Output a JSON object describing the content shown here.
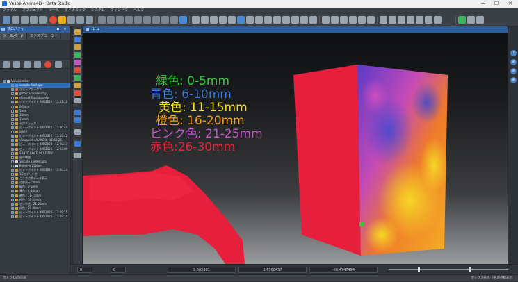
{
  "window": {
    "title": "Vesoe Anima4D - Data Studio",
    "min": "—",
    "max": "☐",
    "close": "✕"
  },
  "menu": [
    "ファイル",
    "オブジェクト",
    "ツール",
    "ダイナミック",
    "システム",
    "ウィンドウ",
    "ヘルプ"
  ],
  "left_panel": {
    "title": "プロパティ",
    "tabs": [
      "ツールボード",
      "エクスプローラー"
    ],
    "tree": [
      {
        "label": "ViewpointSet",
        "checked": true,
        "color": "#cfd5db",
        "indent": 0
      },
      {
        "label": "sample-filed.npo",
        "checked": true,
        "color": "#5aa0e0",
        "indent": 1,
        "selected": true
      },
      {
        "label": "クリップボックス",
        "checked": true,
        "color": "#e06060",
        "indent": 1
      },
      {
        "label": "glitter Stashbounty",
        "checked": false,
        "color": "#d0a040",
        "indent": 1
      },
      {
        "label": "skimset Stashbounty",
        "checked": false,
        "color": "#d0a040",
        "indent": 1
      },
      {
        "label": "ビューポイント 4/6/2020 - 11:31:10",
        "checked": true,
        "color": "#d0a040",
        "indent": 1
      },
      {
        "label": "0-5mm",
        "checked": false,
        "color": "#d0a040",
        "indent": 1
      },
      {
        "label": "5mm",
        "checked": false,
        "color": "#d0a040",
        "indent": 1
      },
      {
        "label": "10mm",
        "checked": false,
        "color": "#d0a040",
        "indent": 1
      },
      {
        "label": "15mm",
        "checked": false,
        "color": "#d0a040",
        "indent": 1
      },
      {
        "label": "干渉チェック",
        "checked": false,
        "color": "#d0a040",
        "indent": 1
      },
      {
        "label": "ビューポイント 4/6/2020 - 11:46:44",
        "checked": true,
        "color": "#d0a040",
        "indent": 1
      },
      {
        "label": "説明文",
        "checked": false,
        "color": "#d0a040",
        "indent": 1
      },
      {
        "label": "ビューポイント 4/6/2020 - 11:59:42",
        "checked": true,
        "color": "#d0a040",
        "indent": 1
      },
      {
        "label": "Viewpoint 4/6/2020 - 11:59:26",
        "checked": true,
        "color": "#d0a040",
        "indent": 1
      },
      {
        "label": "ビューポイント 4/6/2020 - 12:00:17",
        "checked": true,
        "color": "#d0a040",
        "indent": 1
      },
      {
        "label": "ビューポイント 4/6/2020 - 12:03:09",
        "checked": true,
        "color": "#d0a040",
        "indent": 1
      },
      {
        "label": "SANYO ROAD INDUSTRY",
        "checked": false,
        "color": "#d0a040",
        "indent": 1
      },
      {
        "label": "面の構成",
        "checked": false,
        "color": "#d0a040",
        "indent": 1
      },
      {
        "label": "Snipple 250mm.obj",
        "checked": false,
        "color": "#cfd5db",
        "indent": 1
      },
      {
        "label": "Belmine 250mm",
        "checked": false,
        "color": "#cfd5db",
        "indent": 1
      },
      {
        "label": "ビューポイント 4/6/2020 - 13:00:24",
        "checked": true,
        "color": "#d0a040",
        "indent": 1
      },
      {
        "label": "3Dモデリング",
        "checked": false,
        "color": "#d0a040",
        "indent": 1
      },
      {
        "label": "ここで点群データ表示",
        "checked": false,
        "color": "#d0a040",
        "indent": 1
      },
      {
        "label": "点群表示 : 0mm",
        "checked": false,
        "color": "#d0a040",
        "indent": 1
      },
      {
        "label": "緑色 : 0-5mm",
        "checked": true,
        "color": "#d0a040",
        "indent": 1
      },
      {
        "label": "青色 : 6-10mm",
        "checked": true,
        "color": "#d0a040",
        "indent": 1
      },
      {
        "label": "黄色 : 11-15mm",
        "checked": true,
        "color": "#d0a040",
        "indent": 1
      },
      {
        "label": "橙色 : 16-20mm",
        "checked": true,
        "color": "#d0a040",
        "indent": 1
      },
      {
        "label": "ピンク色 : 21-25mm",
        "checked": true,
        "color": "#d0a040",
        "indent": 1
      },
      {
        "label": "赤色 : 26-30mm",
        "checked": true,
        "color": "#d0a040",
        "indent": 1
      },
      {
        "label": "ビューポイント 4/6/2020 - 13:49:15",
        "checked": true,
        "color": "#d0a040",
        "indent": 1
      },
      {
        "label": "ビューポイント 4/6/2020 - 13:49:24",
        "checked": true,
        "color": "#d0a040",
        "indent": 1
      }
    ]
  },
  "viewport": {
    "title": "ビュー"
  },
  "legend": [
    {
      "text": "緑色: 0-5mm",
      "color": "#2ec832"
    },
    {
      "text": "青色: 6-10mm",
      "color": "#3a7bd5"
    },
    {
      "text": "黄色: 11-15mm",
      "color": "#f2e21a"
    },
    {
      "text": "橙色: 16-20mm",
      "color": "#f5a01a"
    },
    {
      "text": "ピンク色: 21-25mm",
      "color": "#c458c8"
    },
    {
      "text": "赤色:26-30mm",
      "color": "#e8213a"
    }
  ],
  "coords": {
    "spin1": "0",
    "spin2": "0",
    "x": "9.502301",
    "y": "5.6708457",
    "z": "-66.4747494"
  },
  "status": {
    "left": "カメラ Defense",
    "right": "ボックス分析: 7名の点群表示"
  },
  "right_strip": [
    "?",
    "⊘",
    "⊘",
    "⊘"
  ]
}
